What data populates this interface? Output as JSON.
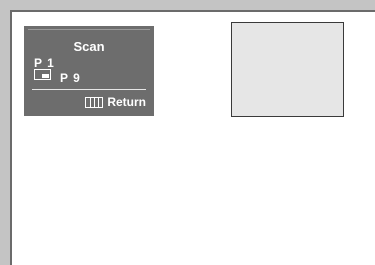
{
  "osd": {
    "title": "Scan",
    "main_channel": "P 1",
    "sub_channel": "P 9",
    "return_label": "Return",
    "icons": {
      "pip": "pip-icon",
      "menu": "menu-icon"
    }
  },
  "colors": {
    "outer_bezel": "#c4c4c4",
    "screen": "#ffffff",
    "osd_background": "#6d6d6d",
    "osd_text": "#ffffff",
    "pip_window": "#e6e6e6"
  }
}
